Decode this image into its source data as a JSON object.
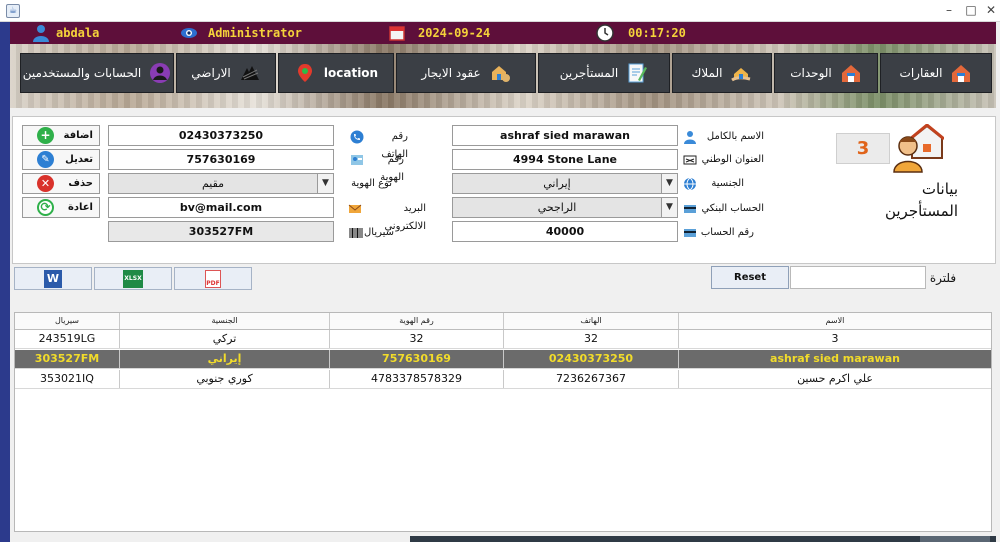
{
  "window": {
    "app_icon": "java-app-icon",
    "minimize": "–",
    "maximize": "□",
    "close": "✕"
  },
  "header": {
    "username": "abdala",
    "role": "Administrator",
    "date": "2024-09-24",
    "time": "00:17:20"
  },
  "nav": {
    "items": [
      {
        "label": "العقارات",
        "icon": "house-icon"
      },
      {
        "label": "الوحدات",
        "icon": "house-icon"
      },
      {
        "label": "الملاك",
        "icon": "owner-icon"
      },
      {
        "label": "المستأجرين",
        "icon": "tenant-icon"
      },
      {
        "label": "عقود الايجار",
        "icon": "contract-icon"
      },
      {
        "label": "location",
        "icon": "location-pin-icon"
      },
      {
        "label": "الاراضي",
        "icon": "land-icon"
      },
      {
        "label": "الحسابات والمستخدمين",
        "icon": "accounts-icon"
      }
    ]
  },
  "form": {
    "title": "بيانات المستأجرين",
    "count": "3",
    "labels": {
      "full_name": "الاسم بالكامل",
      "national_address": "العنوان الوطني",
      "nationality": "الجنسية",
      "bank_account": "الحساب البنكي",
      "account_number": "رقم الحساب",
      "phone": "رقم الهاتف",
      "id_number": "رقم الهوية",
      "id_type": "نوع الهوية",
      "email": "البريد الالكتروني",
      "serial": "سيريال"
    },
    "values": {
      "full_name": "ashraf sied marawan",
      "national_address": "4994 Stone Lane",
      "nationality": "إيراني",
      "bank_account": "الراجحي",
      "account_number": "40000",
      "phone": "02430373250",
      "id_number": "757630169",
      "id_type": "مقيم",
      "email": "bv@mail.com",
      "serial": "303527FM"
    },
    "actions": {
      "add": "اضافة",
      "edit": "تعديل",
      "delete": "حذف",
      "reload": "اعادة"
    }
  },
  "exports": {
    "word": "W",
    "excel": "XLSX",
    "pdf": "PDF"
  },
  "filter": {
    "reset_label": "Reset",
    "label": "فلترة",
    "value": ""
  },
  "table": {
    "headers": [
      "سيريال",
      "الجنسية",
      "رقم الهوية",
      "الهاتف",
      "الاسم"
    ],
    "rows": [
      [
        "243519LG",
        "تركي",
        "32",
        "32",
        "3"
      ],
      [
        "303527FM",
        "إيراني",
        "757630169",
        "02430373250",
        "ashraf sied marawan"
      ],
      [
        "353021IQ",
        "كوري جنوبي",
        "4783378578329",
        "7236267367",
        "علي اكرم حسين"
      ]
    ],
    "selected_row": 1
  },
  "colors": {
    "header_bg": "#5e0f3a",
    "header_text": "#f5d33a",
    "nav_bg": "#3b3f45",
    "selected_row_bg": "#6b6b6b",
    "selected_row_text": "#f2dc2a",
    "count_text": "#e0641a"
  }
}
